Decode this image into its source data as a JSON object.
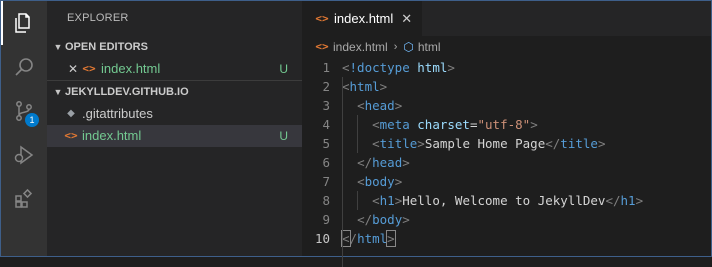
{
  "sidebar": {
    "title": "EXPLORER",
    "open_editors": {
      "label": "OPEN EDITORS",
      "items": [
        {
          "name": "index.html",
          "status": "U"
        }
      ]
    },
    "project": {
      "label": "JEKYLLDEV.GITHUB.IO",
      "files": [
        {
          "name": ".gitattributes",
          "status": ""
        },
        {
          "name": "index.html",
          "status": "U"
        }
      ]
    }
  },
  "activity_bar": {
    "icons": [
      "explorer-icon",
      "search-icon",
      "source-control-icon",
      "run-debug-icon",
      "extensions-icon"
    ],
    "scm_badge": "1"
  },
  "editor": {
    "tab_label": "index.html",
    "breadcrumb": {
      "file": "index.html",
      "symbol": "html"
    },
    "line_numbers": [
      "1",
      "2",
      "3",
      "4",
      "5",
      "6",
      "7",
      "8",
      "9",
      "10"
    ],
    "code": {
      "l1_tag": "!doctype",
      "l1_attr": "html",
      "l2_tag": "html",
      "l3_tag": "head",
      "l4_tag": "meta",
      "l4_attr": "charset",
      "l4_val": "\"utf-8\"",
      "l5_tag": "title",
      "l5_text": "Sample Home Page",
      "l5_close": "title",
      "l6_tag": "head",
      "l7_tag": "body",
      "l8_tag": "h1",
      "l8_text": "Hello, Welcome to JekyllDev",
      "l8_close": "h1",
      "l9_tag": "body",
      "l10_tag": "html"
    }
  },
  "colors": {
    "accent": "#007acc",
    "untracked": "#73c991",
    "html_icon": "#e37933"
  }
}
